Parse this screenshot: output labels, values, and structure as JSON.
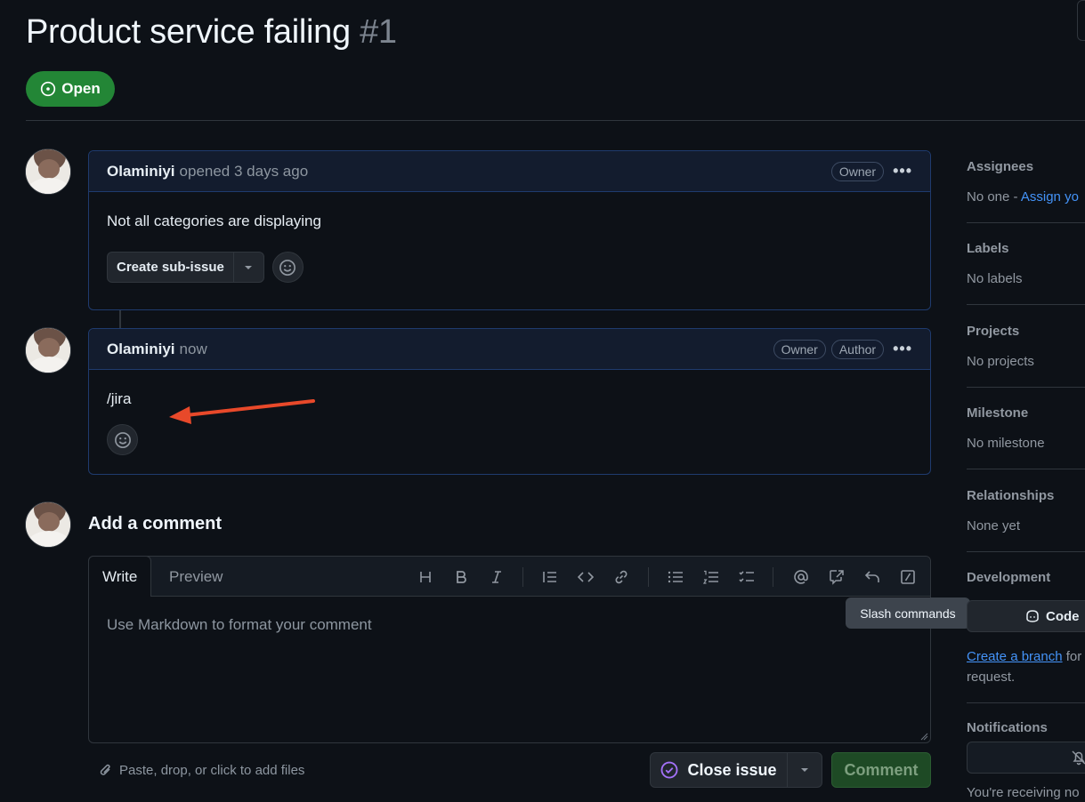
{
  "issue": {
    "title": "Product service failing",
    "number": "#1",
    "state": "Open"
  },
  "comments": [
    {
      "author": "Olaminiyi",
      "meta": "opened 3 days ago",
      "badges": [
        "Owner"
      ],
      "body": "Not all categories are displaying",
      "sub_issue_label": "Create sub-issue"
    },
    {
      "author": "Olaminiyi",
      "meta": "now",
      "badges": [
        "Owner",
        "Author"
      ],
      "body": "/jira"
    }
  ],
  "composer": {
    "title": "Add a comment",
    "tabs": [
      "Write",
      "Preview"
    ],
    "placeholder": "Use Markdown to format your comment",
    "tooltip": "Slash commands",
    "attach_hint": "Paste, drop, or click to add files",
    "close_label": "Close issue",
    "comment_label": "Comment",
    "toolbar_icons": [
      "heading-icon",
      "bold-icon",
      "italic-icon",
      "quote-icon",
      "code-icon",
      "link-icon",
      "unordered-list-icon",
      "ordered-list-icon",
      "task-list-icon",
      "mention-icon",
      "reference-icon",
      "saved-reply-icon",
      "slash-command-icon"
    ]
  },
  "sidebar": {
    "assignees": {
      "label": "Assignees",
      "value": "No one - ",
      "link": "Assign yo"
    },
    "labels": {
      "label": "Labels",
      "value": "No labels"
    },
    "projects": {
      "label": "Projects",
      "value": "No projects"
    },
    "milestone": {
      "label": "Milestone",
      "value": "No milestone"
    },
    "relationships": {
      "label": "Relationships",
      "value": "None yet"
    },
    "development": {
      "label": "Development",
      "code_button": "Code",
      "link": "Create a branch",
      "text_after": " for",
      "text_line2": "request."
    },
    "notifications": {
      "label": "Notifications",
      "status": "You're receiving no"
    }
  },
  "colors": {
    "open_badge": "#238636",
    "accent_link": "#4493f8",
    "annotation_arrow": "#e8492a"
  }
}
